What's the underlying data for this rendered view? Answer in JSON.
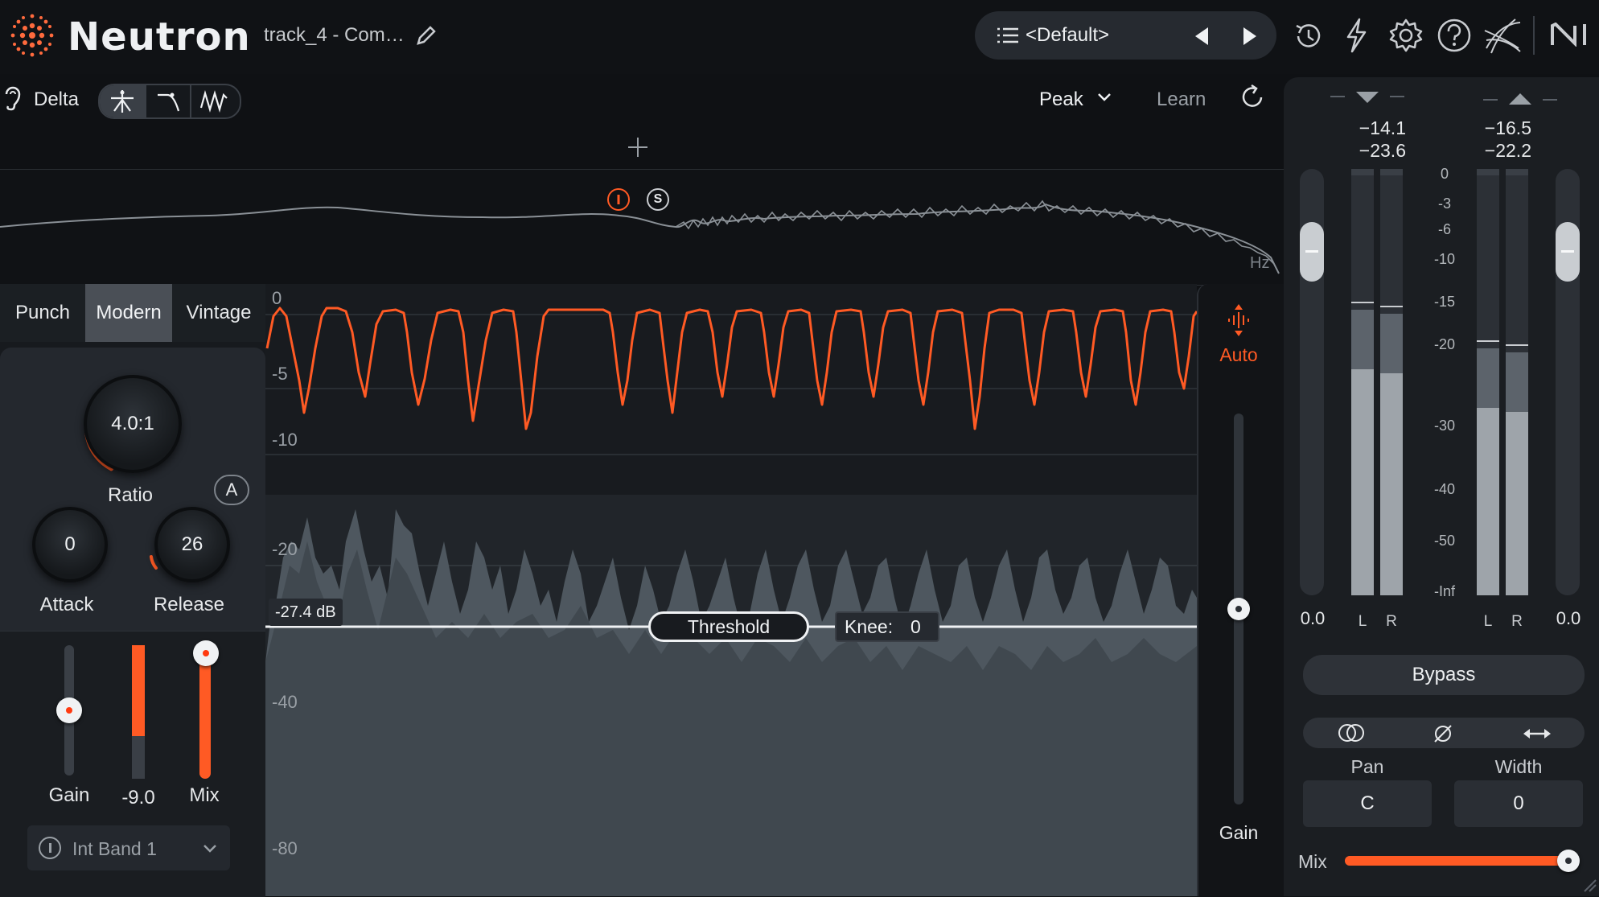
{
  "app": {
    "name": "Neutron",
    "track_title": "track_4 - Com…"
  },
  "preset": {
    "name": "<Default>"
  },
  "toolbar": {
    "icons": [
      "list-icon",
      "prev-arrow-icon",
      "next-arrow-icon",
      "history-icon",
      "lightning-icon",
      "gear-icon",
      "help-icon",
      "mesh-icon",
      "ni-logo-icon"
    ]
  },
  "secondary": {
    "delta_label": "Delta",
    "detection": "Peak",
    "learn_label": "Learn"
  },
  "spectrum": {
    "hz_label": "Hz",
    "band_marker_solo": "S"
  },
  "style_tabs": [
    {
      "label": "Punch"
    },
    {
      "label": "Modern",
      "active": true
    },
    {
      "label": "Vintage"
    }
  ],
  "knobs": {
    "ratio": {
      "value": "4.0:1",
      "label": "Ratio"
    },
    "auto_badge": "A",
    "attack": {
      "value": "0",
      "label": "Attack"
    },
    "release": {
      "value": "26",
      "label": "Release"
    }
  },
  "lower": {
    "gain_label": "Gain",
    "gr_value": "-9.0",
    "mix_label": "Mix",
    "sidechain": "Int Band 1",
    "gain_level": 0.5,
    "gr_level": 0.68,
    "mix_level": 1.0
  },
  "graph": {
    "y_ticks": [
      "0",
      "-5",
      "-10",
      "-20",
      "-40",
      "-80"
    ],
    "threshold_value": "-27.4 dB",
    "threshold_label": "Threshold",
    "knee_label": "Knee:",
    "knee_value": "0"
  },
  "gain_strip": {
    "auto_label": "Auto",
    "gain_label": "Gain",
    "gain_level": 0.5
  },
  "meters": {
    "input": {
      "peak": "−14.1",
      "rms": "−23.6",
      "fader_value": "0.0",
      "l_label": "L",
      "r_label": "R",
      "l_level": 0.53,
      "r_level": 0.52
    },
    "output": {
      "peak": "−16.5",
      "rms": "−22.2",
      "fader_value": "0.0",
      "l_label": "L",
      "r_label": "R",
      "l_level": 0.44,
      "r_level": 0.43
    },
    "scale": [
      "0",
      "-3",
      "-6",
      "-10",
      "-15",
      "-20",
      "-30",
      "-40",
      "-50",
      "-Inf"
    ]
  },
  "bypass_label": "Bypass",
  "stereo": {
    "pan_label": "Pan",
    "pan_value": "C",
    "width_label": "Width",
    "width_value": "0"
  },
  "output_mix": {
    "label": "Mix",
    "level": 1.0
  },
  "colors": {
    "accent": "#ff5a24",
    "background": "#0f1114",
    "panel": "#24282e"
  }
}
